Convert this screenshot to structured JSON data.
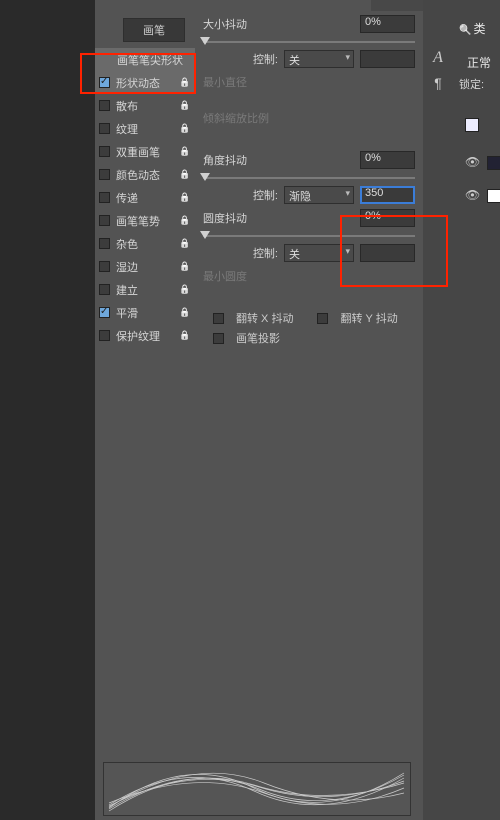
{
  "tabs": {
    "brush_tab": "画笔"
  },
  "brush_list": {
    "header": "画笔笔尖形状",
    "items": [
      {
        "label": "形状动态",
        "on": true
      },
      {
        "label": "散布",
        "on": false
      },
      {
        "label": "纹理",
        "on": false
      },
      {
        "label": "双重画笔",
        "on": false
      },
      {
        "label": "颜色动态",
        "on": false
      },
      {
        "label": "传递",
        "on": false
      },
      {
        "label": "画笔笔势",
        "on": false
      },
      {
        "label": "杂色",
        "on": false
      },
      {
        "label": "湿边",
        "on": false
      },
      {
        "label": "建立",
        "on": false
      },
      {
        "label": "平滑",
        "on": true
      },
      {
        "label": "保护纹理",
        "on": false
      }
    ]
  },
  "opts": {
    "size_jitter": {
      "label": "大小抖动",
      "value": "0%"
    },
    "control1": {
      "label": "控制:",
      "sel": "关",
      "field": ""
    },
    "min_diameter": {
      "label": "最小直径"
    },
    "tilt_scale": {
      "label": "倾斜缩放比例"
    },
    "angle_jitter": {
      "label": "角度抖动",
      "value": "0%"
    },
    "control2": {
      "label": "控制:",
      "sel": "渐隐",
      "field": "350"
    },
    "round_jitter": {
      "label": "圆度抖动",
      "value": "0%"
    },
    "control3": {
      "label": "控制:",
      "sel": "关",
      "field": ""
    },
    "min_round": {
      "label": "最小圆度"
    },
    "flip_x": {
      "label": "翻转 X 抖动"
    },
    "flip_y": {
      "label": "翻转 Y 抖动"
    },
    "proj": {
      "label": "画笔投影"
    }
  },
  "right": {
    "search": "类",
    "mode": "正常",
    "lock": "锁定:"
  },
  "tools": {
    "text": "A",
    "para": "¶"
  }
}
